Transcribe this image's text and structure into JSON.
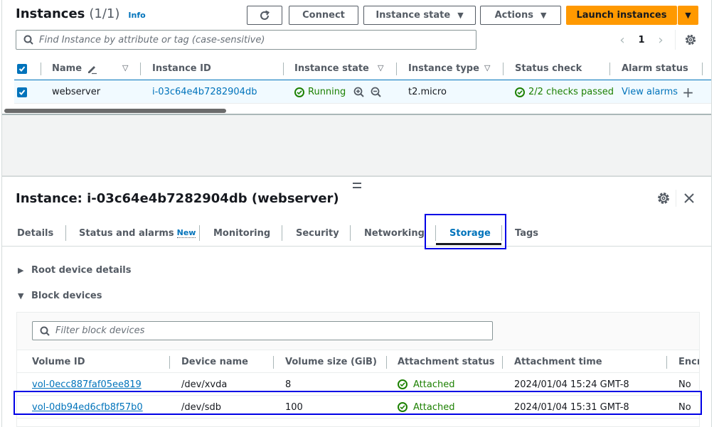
{
  "instances_header": {
    "title": "Instances",
    "count": "(1/1)",
    "info": "Info"
  },
  "toolbar": {
    "refresh_icon": "refresh-icon",
    "connect": "Connect",
    "instance_state": "Instance state",
    "actions": "Actions",
    "launch": "Launch instances"
  },
  "search": {
    "placeholder": "Find Instance by attribute or tag (case-sensitive)"
  },
  "pagination": {
    "prev": "‹",
    "page": "1",
    "next": "›"
  },
  "instances_table": {
    "columns": [
      "Name",
      "Instance ID",
      "Instance state",
      "Instance type",
      "Status check",
      "Alarm status"
    ],
    "rows": [
      {
        "selected": true,
        "name": "webserver",
        "instance_id": "i-03c64e4b7282904db",
        "state": "Running",
        "type": "t2.micro",
        "status_check": "2/2 checks passed",
        "alarm": "View alarms"
      }
    ]
  },
  "details": {
    "title": "Instance: i-03c64e4b7282904db (webserver)",
    "tabs": [
      {
        "label": "Details"
      },
      {
        "label": "Status and alarms",
        "badge": "New"
      },
      {
        "label": "Monitoring"
      },
      {
        "label": "Security"
      },
      {
        "label": "Networking"
      },
      {
        "label": "Storage",
        "active": true
      },
      {
        "label": "Tags"
      }
    ],
    "sections": {
      "root": "Root device details",
      "block": "Block devices"
    },
    "block_filter_placeholder": "Filter block devices",
    "block_table": {
      "columns": [
        "Volume ID",
        "Device name",
        "Volume size (GiB)",
        "Attachment status",
        "Attachment time",
        "Encr"
      ],
      "rows": [
        {
          "volume_id": "vol-0ecc887faf05ee819",
          "device": "/dev/xvda",
          "size": "8",
          "status": "Attached",
          "time": "2024/01/04 15:24 GMT-8",
          "encrypted": "No"
        },
        {
          "volume_id": "vol-0db94ed6cfb8f57b0",
          "device": "/dev/sdb",
          "size": "100",
          "status": "Attached",
          "time": "2024/01/04 15:31 GMT-8",
          "encrypted": "No",
          "highlighted": true
        }
      ]
    }
  },
  "colors": {
    "accent": "#0073bb",
    "launch": "#ff9900",
    "success": "#1d8102",
    "highlight": "#0000e6"
  }
}
